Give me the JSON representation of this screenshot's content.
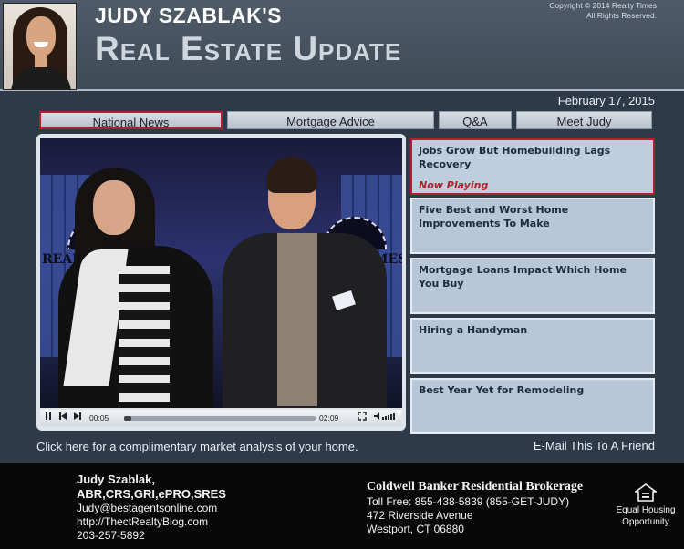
{
  "header": {
    "agent_name": "JUDY SZABLAK'S",
    "title": "Real Estate Update",
    "copyright_line1": "Copyright © 2014 Realty Times",
    "copyright_line2": "All Rights Reserved."
  },
  "date": "February 17, 2015",
  "tabs": [
    {
      "label": "National News"
    },
    {
      "label": "Mortgage Advice"
    },
    {
      "label": "Q&A"
    },
    {
      "label": "Meet Judy"
    }
  ],
  "player": {
    "time_current": "00:05",
    "time_total": "02:09",
    "progress_fraction": 0.04,
    "brand_left": "REALT",
    "brand_right": "MES",
    "icons": {
      "pause": "pause-icon",
      "prev": "skip-back-icon",
      "next": "skip-forward-icon",
      "fullscreen": "fullscreen-icon",
      "volume": "volume-icon"
    }
  },
  "playlist": [
    {
      "title": "Jobs Grow But Homebuilding Lags Recovery",
      "status": "Now Playing"
    },
    {
      "title": "Five Best and Worst Home Improvements To Make"
    },
    {
      "title": "Mortgage Loans Impact Which Home You Buy"
    },
    {
      "title": "Hiring a Handyman"
    },
    {
      "title": "Best Year Yet for Remodeling"
    }
  ],
  "links": {
    "cta": "Click here for a complimentary market analysis of your home.",
    "email": "E-Mail This To A Friend"
  },
  "footer": {
    "agent": {
      "name": "Judy Szablak,",
      "credentials": "ABR,CRS,GRI,ePRO,SRES",
      "email": "Judy@bestagentsonline.com",
      "blog": "http://ThectRealtyBlog.com",
      "phone": "203-257-5892"
    },
    "broker": {
      "name": "Coldwell Banker Residential Brokerage",
      "toll_free": "Toll Free: 855-438-5839 (855-GET-JUDY)",
      "address1": "472 Riverside Avenue",
      "address2": "Westport, CT 06880"
    },
    "equal_housing_line1": "Equal Housing",
    "equal_housing_line2": "Opportunity"
  }
}
